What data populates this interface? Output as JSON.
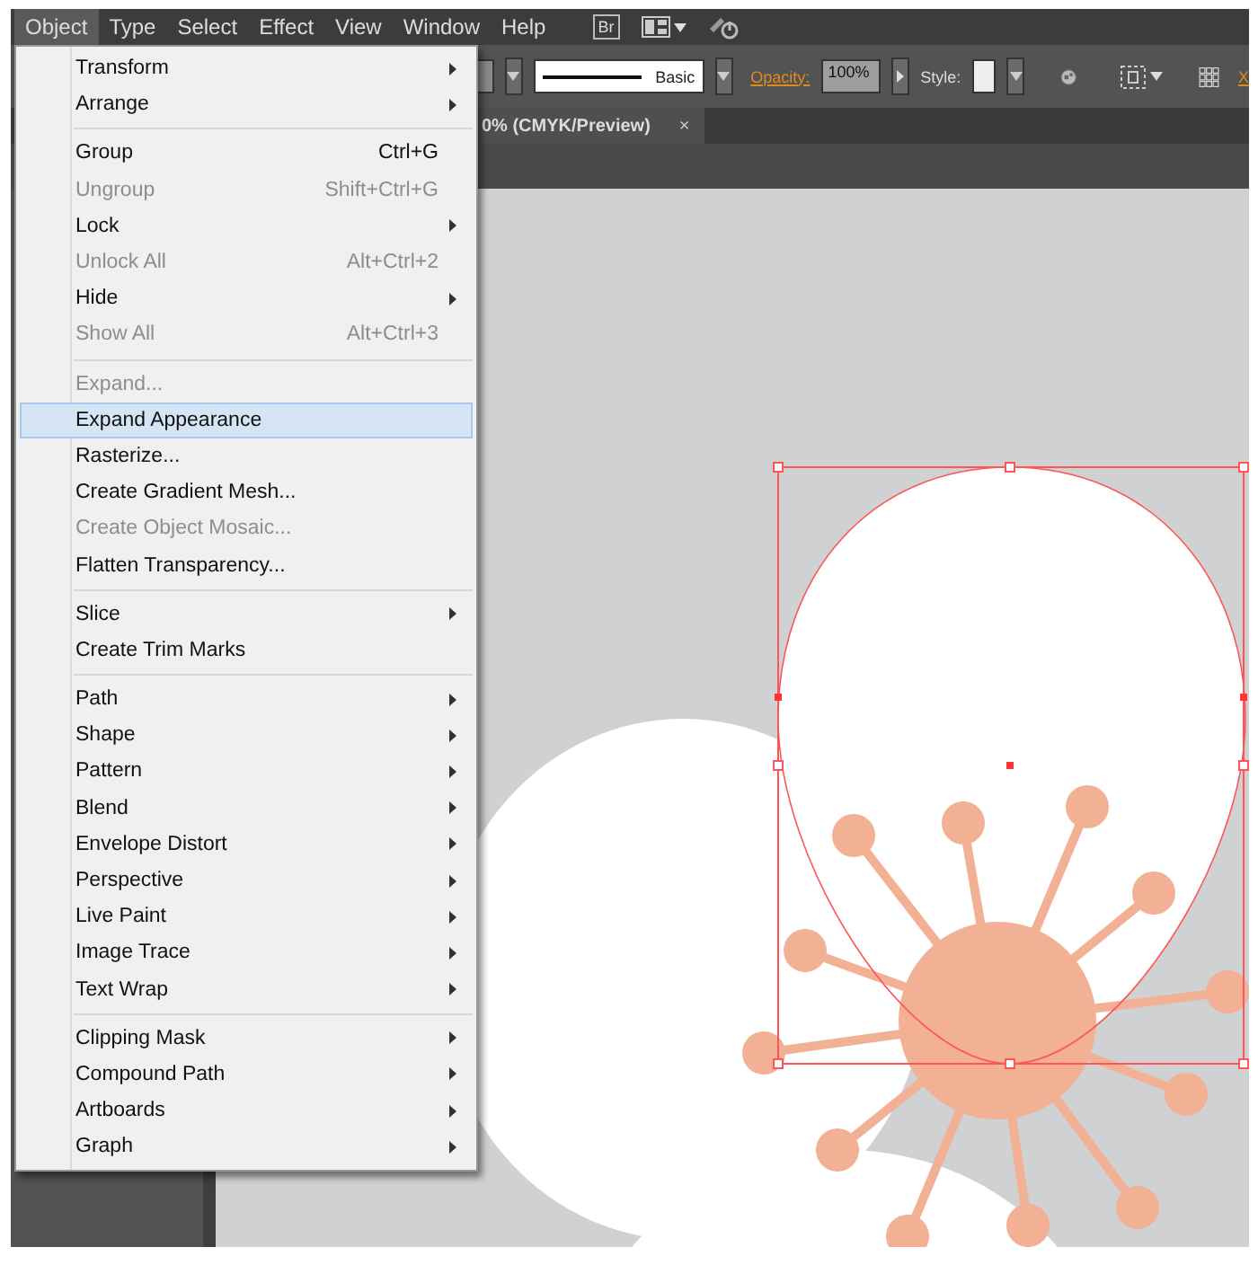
{
  "menubar": [
    {
      "label": "Object",
      "selected": true
    },
    {
      "label": "Type",
      "selected": false
    },
    {
      "label": "Select",
      "selected": false
    },
    {
      "label": "Effect",
      "selected": false
    },
    {
      "label": "View",
      "selected": false
    },
    {
      "label": "Window",
      "selected": false
    },
    {
      "label": "Help",
      "selected": false
    }
  ],
  "bridge_button": "Br",
  "control_bar": {
    "stroke_label": "Basic",
    "opacity_label": "Opacity:",
    "opacity_value": "100%",
    "style_label": "Style:",
    "x_label": "X"
  },
  "document_tab": {
    "title": "0% (CMYK/Preview)",
    "close": "×"
  },
  "menu": [
    [
      {
        "label": "Transform",
        "submenu": true,
        "disabled": false,
        "selected": false
      },
      {
        "label": "Arrange",
        "submenu": true,
        "disabled": false,
        "selected": false
      }
    ],
    [
      {
        "label": "Group",
        "shortcut": "Ctrl+G",
        "submenu": false,
        "disabled": false,
        "selected": false
      },
      {
        "label": "Ungroup",
        "shortcut": "Shift+Ctrl+G",
        "submenu": false,
        "disabled": true,
        "selected": false
      },
      {
        "label": "Lock",
        "submenu": true,
        "disabled": false,
        "selected": false
      },
      {
        "label": "Unlock All",
        "shortcut": "Alt+Ctrl+2",
        "submenu": false,
        "disabled": true,
        "selected": false
      },
      {
        "label": "Hide",
        "submenu": true,
        "disabled": false,
        "selected": false
      },
      {
        "label": "Show All",
        "shortcut": "Alt+Ctrl+3",
        "submenu": false,
        "disabled": true,
        "selected": false
      }
    ],
    [
      {
        "label": "Expand...",
        "submenu": false,
        "disabled": true,
        "selected": false
      },
      {
        "label": "Expand Appearance",
        "submenu": false,
        "disabled": false,
        "selected": true
      },
      {
        "label": "Rasterize...",
        "submenu": false,
        "disabled": false,
        "selected": false
      },
      {
        "label": "Create Gradient Mesh...",
        "submenu": false,
        "disabled": false,
        "selected": false
      },
      {
        "label": "Create Object Mosaic...",
        "submenu": false,
        "disabled": true,
        "selected": false
      },
      {
        "label": "Flatten Transparency...",
        "submenu": false,
        "disabled": false,
        "selected": false
      }
    ],
    [
      {
        "label": "Slice",
        "submenu": true,
        "disabled": false,
        "selected": false
      },
      {
        "label": "Create Trim Marks",
        "submenu": false,
        "disabled": false,
        "selected": false
      }
    ],
    [
      {
        "label": "Path",
        "submenu": true,
        "disabled": false,
        "selected": false
      },
      {
        "label": "Shape",
        "submenu": true,
        "disabled": false,
        "selected": false
      },
      {
        "label": "Pattern",
        "submenu": true,
        "disabled": false,
        "selected": false
      },
      {
        "label": "Blend",
        "submenu": true,
        "disabled": false,
        "selected": false
      },
      {
        "label": "Envelope Distort",
        "submenu": true,
        "disabled": false,
        "selected": false
      },
      {
        "label": "Perspective",
        "submenu": true,
        "disabled": false,
        "selected": false
      },
      {
        "label": "Live Paint",
        "submenu": true,
        "disabled": false,
        "selected": false
      },
      {
        "label": "Image Trace",
        "submenu": true,
        "disabled": false,
        "selected": false
      },
      {
        "label": "Text Wrap",
        "submenu": true,
        "disabled": false,
        "selected": false
      }
    ],
    [
      {
        "label": "Clipping Mask",
        "submenu": true,
        "disabled": false,
        "selected": false
      },
      {
        "label": "Compound Path",
        "submenu": true,
        "disabled": false,
        "selected": false
      },
      {
        "label": "Artboards",
        "submenu": true,
        "disabled": false,
        "selected": false
      },
      {
        "label": "Graph",
        "submenu": true,
        "disabled": false,
        "selected": false
      }
    ]
  ]
}
